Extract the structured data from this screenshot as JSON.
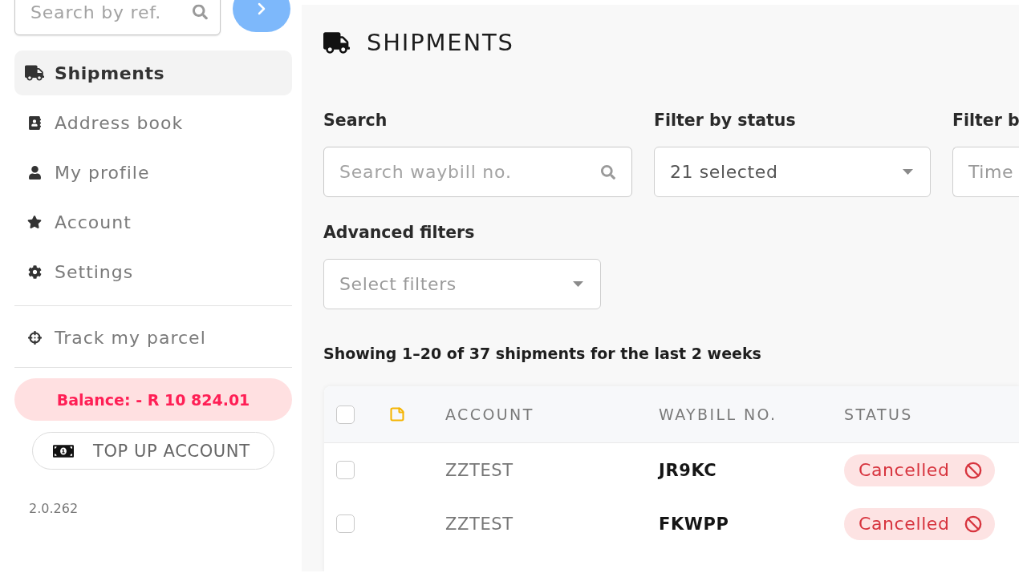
{
  "sidebar": {
    "search": {
      "placeholder": "Search by ref."
    },
    "nav": [
      {
        "label": "Shipments",
        "selected": true
      },
      {
        "label": "Address book",
        "selected": false
      },
      {
        "label": "My profile",
        "selected": false
      },
      {
        "label": "Account",
        "selected": false
      },
      {
        "label": "Settings",
        "selected": false
      }
    ],
    "extra_nav": [
      {
        "label": "Track my parcel",
        "selected": false
      }
    ],
    "balance": "Balance: - R 10 824.01",
    "top_up_button": "TOP UP ACCOUNT",
    "version": "2.0.262"
  },
  "page": {
    "title": "SHIPMENTS"
  },
  "filters": [
    {
      "kind": "search",
      "label": "Search",
      "placeholder": "Search waybill no."
    },
    {
      "kind": "select",
      "label": "Filter by status",
      "value": "21 selected"
    },
    {
      "kind": "text",
      "label": "Filter b",
      "placeholder": "Time"
    }
  ],
  "advanced_filters": {
    "kind": "select",
    "label": "Advanced filters",
    "placeholder": "Select filters"
  },
  "summary": "Showing 1–20 of 37 shipments for the last 2 weeks",
  "table": {
    "header_checked": false,
    "columns": [
      "ACCOUNT",
      "WAYBILL NO.",
      "STATUS"
    ],
    "rows": [
      {
        "checked": false,
        "account": "ZZTEST",
        "waybill": "JR9KC",
        "status": {
          "kind": "cancelled",
          "label": "Cancelled"
        }
      },
      {
        "checked": false,
        "account": "ZZTEST",
        "waybill": "FKWPP",
        "status": {
          "kind": "cancelled",
          "label": "Cancelled"
        }
      }
    ]
  }
}
